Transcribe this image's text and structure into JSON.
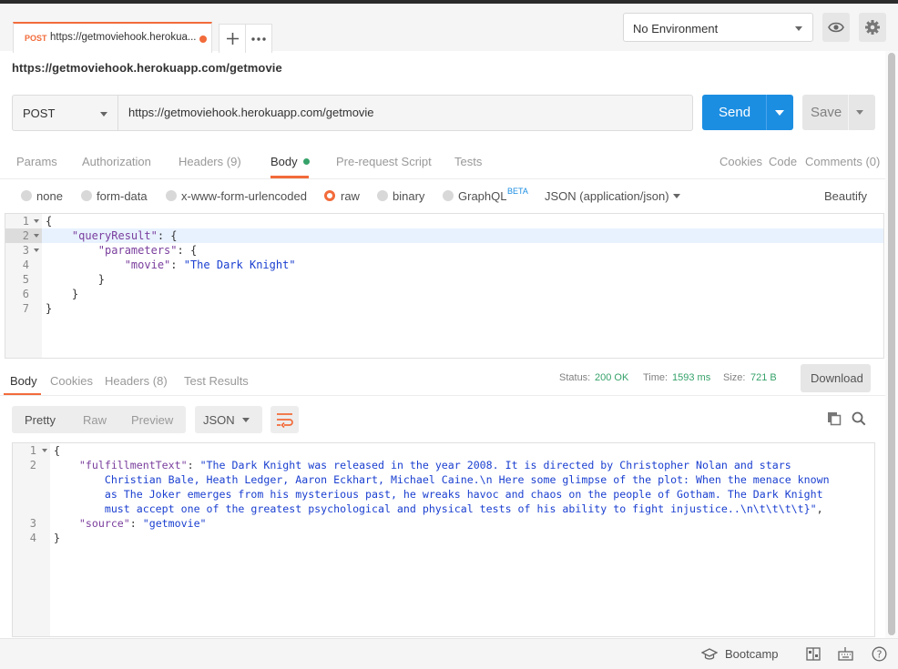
{
  "tab": {
    "method": "POST",
    "title": "https://getmoviehook.herokua..."
  },
  "environment": {
    "selected": "No Environment"
  },
  "request": {
    "title": "https://getmoviehook.herokuapp.com/getmovie",
    "method": "POST",
    "url": "https://getmoviehook.herokuapp.com/getmovie",
    "send_label": "Send",
    "save_label": "Save"
  },
  "request_tabs": {
    "params": "Params",
    "authorization": "Authorization",
    "headers": "Headers",
    "headers_count": "(9)",
    "body": "Body",
    "prerequest": "Pre-request Script",
    "tests": "Tests",
    "cookies": "Cookies",
    "code": "Code",
    "comments": "Comments (0)"
  },
  "body_types": {
    "none": "none",
    "form_data": "form-data",
    "urlencoded": "x-www-form-urlencoded",
    "raw": "raw",
    "binary": "binary",
    "graphql": "GraphQL",
    "beta": "BETA",
    "format": "JSON (application/json)",
    "beautify": "Beautify",
    "selected": "raw"
  },
  "request_body": {
    "line_numbers": [
      "1",
      "2",
      "3",
      "4",
      "5",
      "6",
      "7"
    ],
    "lines": [
      {
        "indent": "",
        "key": "",
        "text": "{"
      },
      {
        "indent": "    ",
        "key": "\"queryResult\"",
        "text": ": {"
      },
      {
        "indent": "        ",
        "key": "\"parameters\"",
        "text": ": {"
      },
      {
        "indent": "            ",
        "key": "\"movie\"",
        "text": ": ",
        "value": "\"The Dark Knight\""
      },
      {
        "indent": "        ",
        "key": "",
        "text": "}"
      },
      {
        "indent": "    ",
        "key": "",
        "text": "}"
      },
      {
        "indent": "",
        "key": "",
        "text": "}"
      }
    ]
  },
  "response": {
    "tabs": {
      "body": "Body",
      "cookies": "Cookies",
      "headers": "Headers",
      "headers_count": "(8)",
      "test_results": "Test Results"
    },
    "status_label": "Status:",
    "status_value": "200 OK",
    "time_label": "Time:",
    "time_value": "1593 ms",
    "size_label": "Size:",
    "size_value": "721 B",
    "download_label": "Download",
    "views": {
      "pretty": "Pretty",
      "raw": "Raw",
      "preview": "Preview"
    },
    "format": "JSON",
    "line_numbers": [
      "1",
      "2",
      "3",
      "4"
    ],
    "lines": [
      {
        "indent": "",
        "key": "",
        "text": "{"
      },
      {
        "indent": "    ",
        "key": "\"fulfillmentText\"",
        "text": ": ",
        "value": "\"The Dark Knight was released in the year 2008. It is directed by Christopher Nolan and stars"
      },
      {
        "indent": "        ",
        "key": "",
        "text": "",
        "value": "Christian Bale, Heath Ledger, Aaron Eckhart, Michael Caine.\\n Here some glimpse of the plot: When the menace known"
      },
      {
        "indent": "        ",
        "key": "",
        "text": "",
        "value": "as The Joker emerges from his mysterious past, he wreaks havoc and chaos on the people of Gotham. The Dark Knight"
      },
      {
        "indent": "        ",
        "key": "",
        "text": "",
        "value": "must accept one of the greatest psychological and physical tests of his ability to fight injustice..\\n\\t\\t\\t\\t}\"",
        "tail": ","
      },
      {
        "indent": "    ",
        "key": "\"source\"",
        "text": ": ",
        "value": "\"getmovie\""
      },
      {
        "indent": "",
        "key": "",
        "text": "}"
      }
    ]
  },
  "statusbar": {
    "bootcamp": "Bootcamp"
  },
  "icons": {
    "plus": "plus-icon",
    "more": "more-icon",
    "eye": "eye-icon",
    "settings": "gear-icon",
    "copy": "copy-icon",
    "search": "search-icon",
    "wrap": "wrap-lines-icon",
    "bootcamp": "bootcamp-icon",
    "layout": "two-pane-icon",
    "keyboard": "keyboard-icon",
    "help": "help-icon"
  },
  "colors": {
    "accent": "#f26b3a",
    "send": "#1c8ee2",
    "success": "#36a26a"
  }
}
